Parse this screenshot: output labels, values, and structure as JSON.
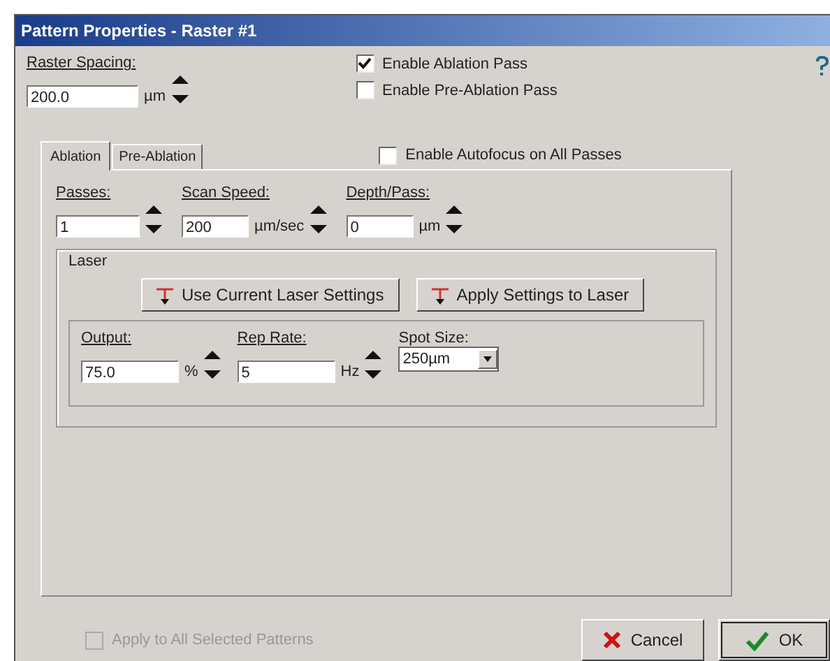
{
  "window": {
    "title": "Pattern Properties - Raster #1"
  },
  "raster_spacing": {
    "label": "Raster Spacing:",
    "value": "200.0",
    "unit": "µm"
  },
  "pass_options": [
    {
      "label": "Enable Ablation Pass",
      "checked": true
    },
    {
      "label": "Enable Pre-Ablation Pass",
      "checked": false
    }
  ],
  "tabs": [
    {
      "label": "Ablation",
      "selected": true
    },
    {
      "label": "Pre-Ablation",
      "selected": false
    }
  ],
  "autofocus": {
    "label": "Enable Autofocus on All Passes",
    "checked": false
  },
  "pass_fields": [
    {
      "label": "Passes:",
      "value": "1"
    },
    {
      "label": "Scan Speed:",
      "value": "200",
      "unit": "µm/sec"
    },
    {
      "label": "Depth/Pass:",
      "value": "0",
      "unit": "µm"
    }
  ],
  "laser": {
    "title": "Laser",
    "buttons": [
      "Use Current Laser Settings",
      "Apply Settings to Laser"
    ],
    "fields": [
      {
        "label": "Output:",
        "value": "75.0",
        "unit": "%"
      },
      {
        "label": "Rep Rate:",
        "value": "5",
        "unit": "Hz"
      }
    ],
    "spot_size": {
      "label": "Spot Size:",
      "value": "250µm"
    }
  },
  "apply_all": {
    "label": "Apply to All Selected Patterns",
    "checked": false,
    "disabled": true
  },
  "buttons": [
    {
      "label": "Cancel",
      "kind": "cancel"
    },
    {
      "label": "OK",
      "kind": "ok"
    }
  ]
}
